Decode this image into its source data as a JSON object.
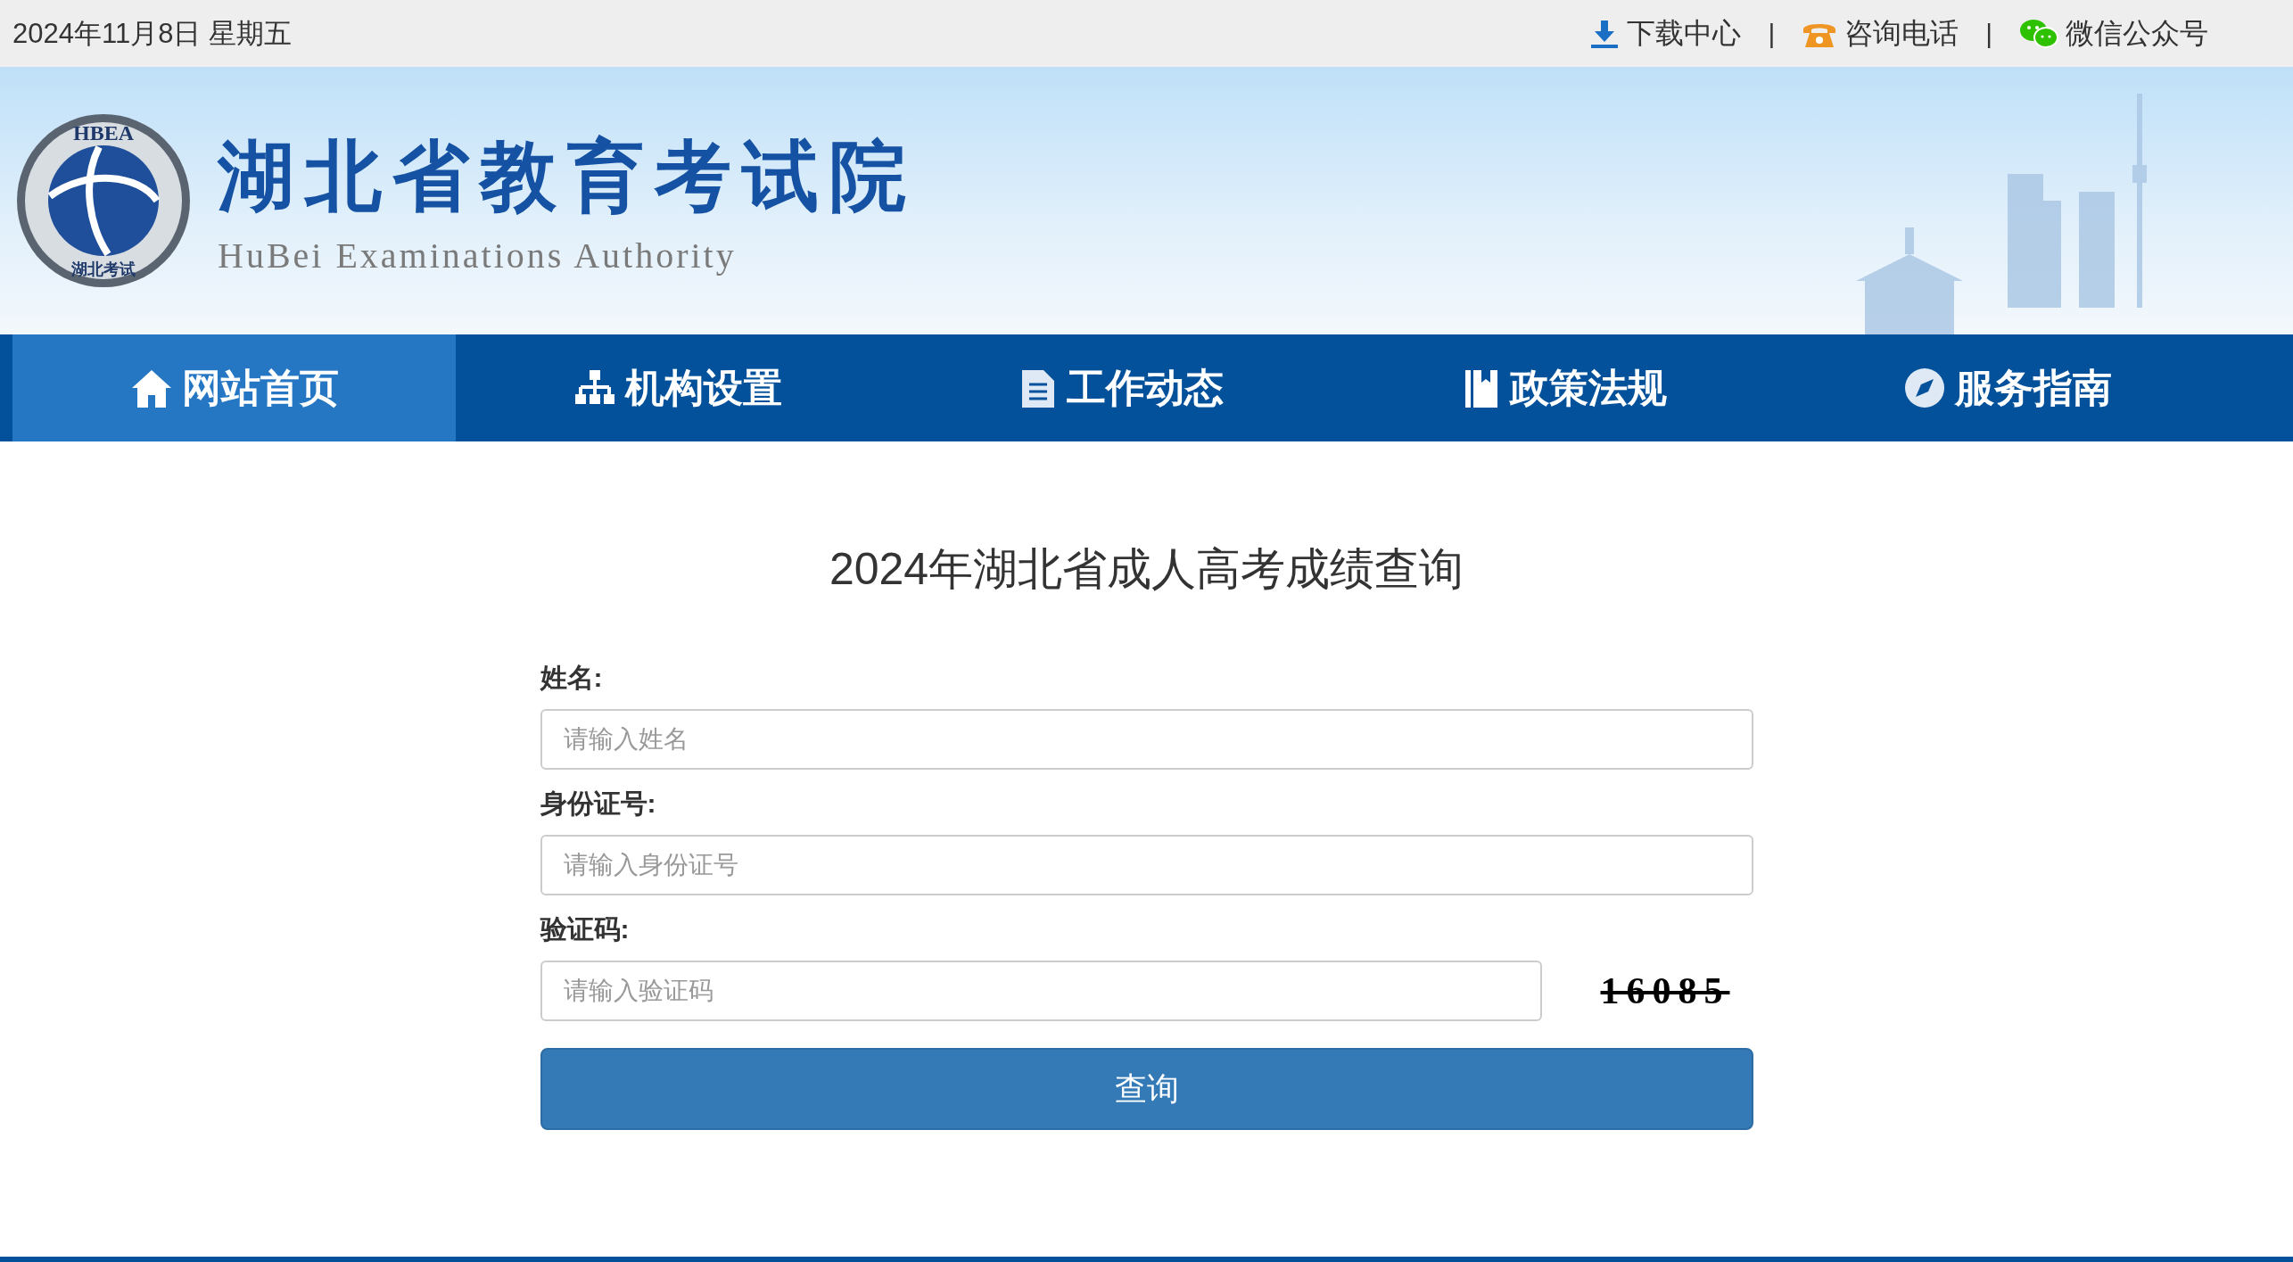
{
  "top_bar": {
    "date": "2024年11月8日 星期五",
    "links": [
      {
        "kind": "download",
        "label": "下载中心"
      },
      {
        "kind": "phone",
        "label": "咨询电话"
      },
      {
        "kind": "wechat",
        "label": "微信公众号"
      }
    ],
    "separator": "|"
  },
  "banner": {
    "logo_ring": "HBEA",
    "logo_bottom": "湖北考试",
    "title": "湖北省教育考试院",
    "subtitle": "HuBei Examinations Authority"
  },
  "nav": [
    {
      "kind": "home",
      "label": "网站首页",
      "selected": true
    },
    {
      "kind": "org",
      "label": "机构设置",
      "selected": false
    },
    {
      "kind": "doc",
      "label": "工作动态",
      "selected": false
    },
    {
      "kind": "book",
      "label": "政策法规",
      "selected": false
    },
    {
      "kind": "compass",
      "label": "服务指南",
      "selected": false
    }
  ],
  "form": {
    "title": "2024年湖北省成人高考成绩查询",
    "fields": [
      {
        "kind": "text",
        "label": "姓名:",
        "placeholder": "请输入姓名"
      },
      {
        "kind": "text",
        "label": "身份证号:",
        "placeholder": "请输入身份证号"
      },
      {
        "kind": "captcha",
        "label": "验证码:",
        "placeholder": "请输入验证码",
        "captcha": "16085"
      }
    ],
    "submit": "查询"
  }
}
